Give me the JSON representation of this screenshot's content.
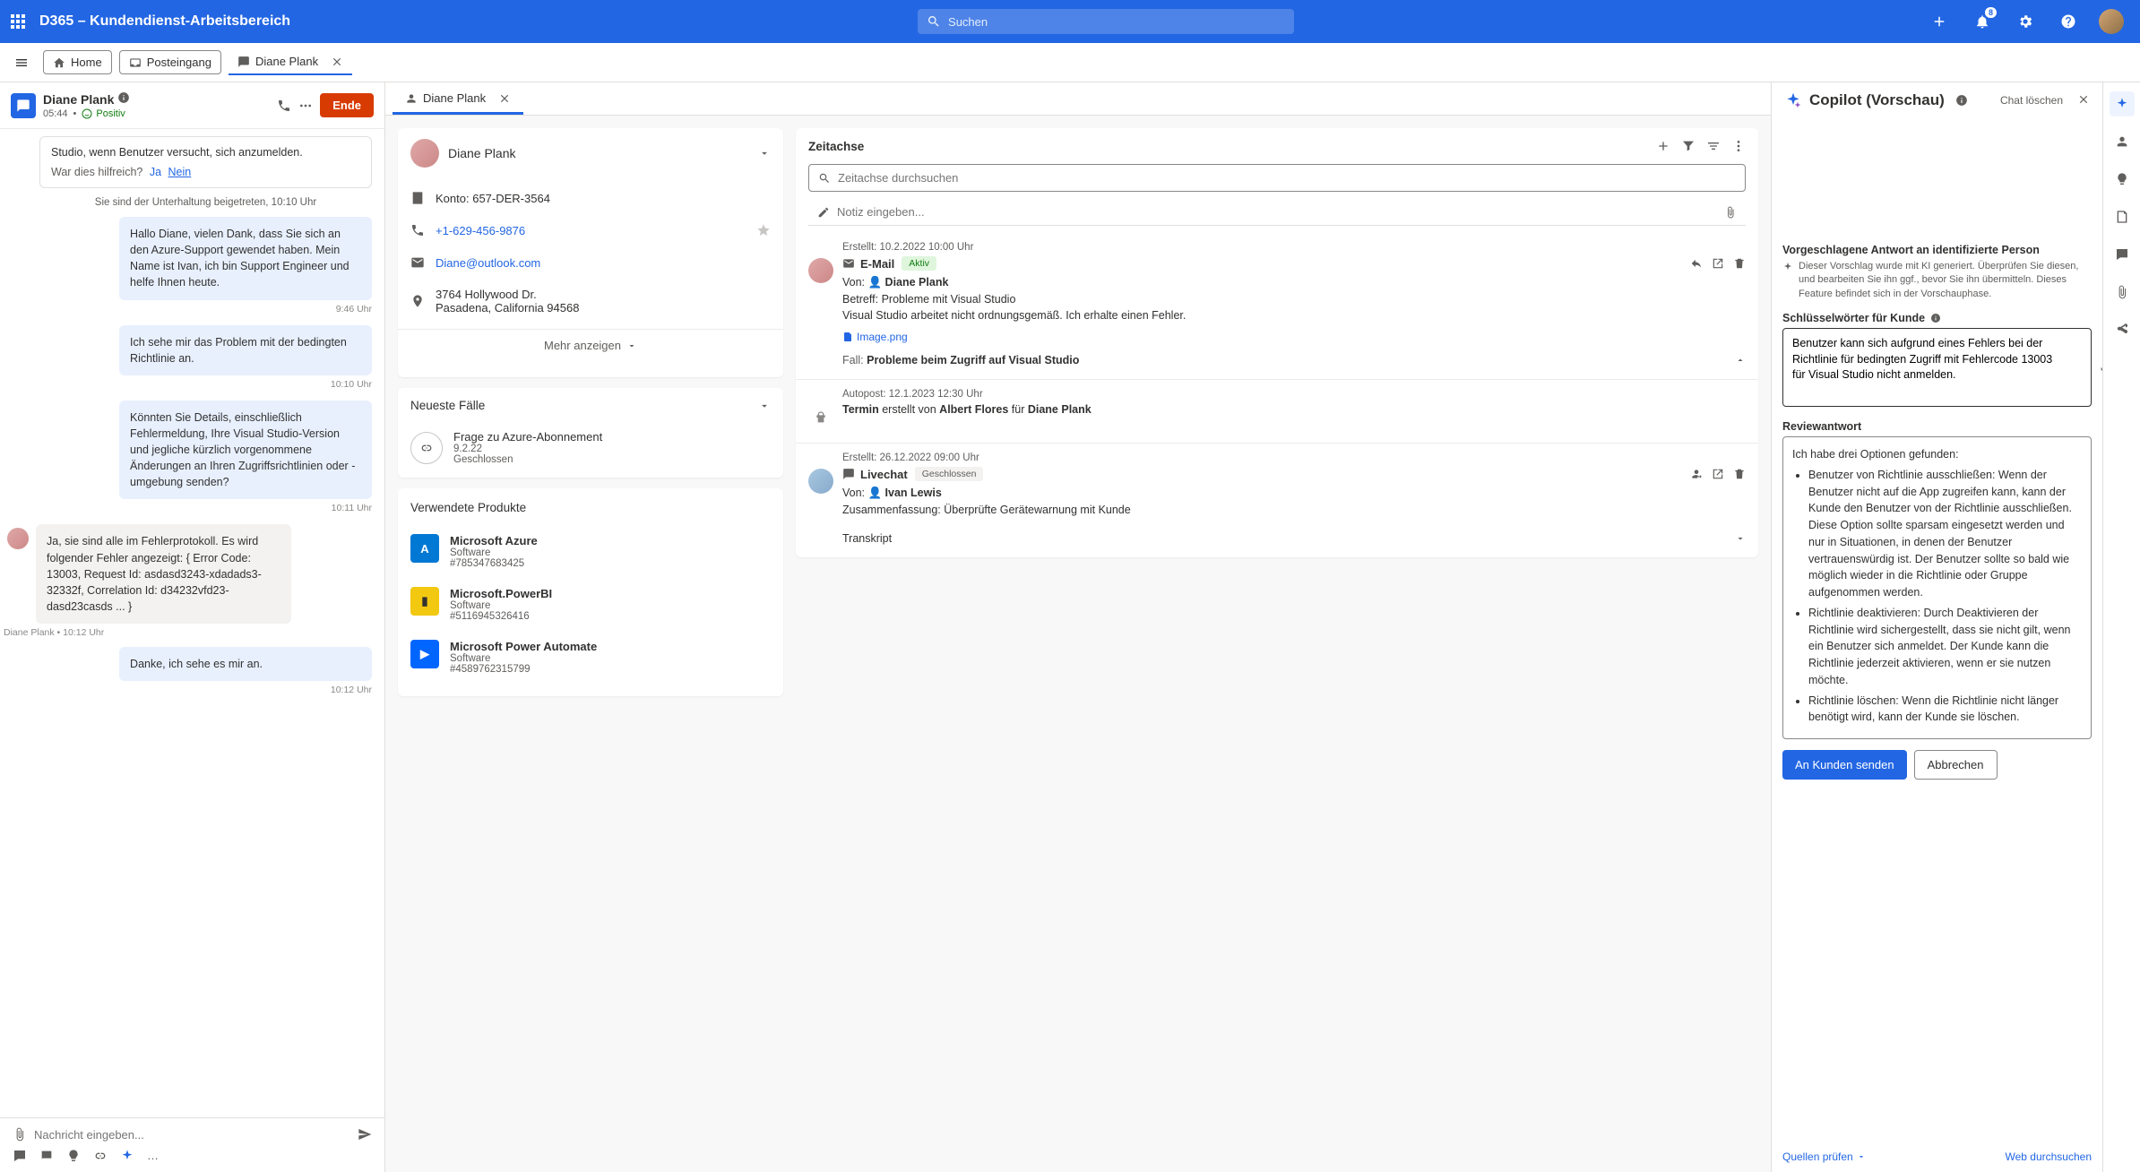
{
  "nav": {
    "app_title": "D365 – Kundendienst-Arbeitsbereich",
    "search_placeholder": "Suchen",
    "notification_count": "8"
  },
  "cmd": {
    "home": "Home",
    "inbox": "Posteingang",
    "tab_name": "Diane Plank"
  },
  "chat_header": {
    "name": "Diane Plank",
    "timer": "05:44",
    "sentiment": "Positiv",
    "end": "Ende"
  },
  "chat": {
    "knowledge_snippet": "Studio, wenn Benutzer versucht, sich anzumelden.",
    "helpful_q": "War dies hilfreich?",
    "yes": "Ja",
    "no": "Nein",
    "joined": "Sie sind der Unterhaltung beigetreten, 10:10 Uhr",
    "m1": "Hallo Diane, vielen Dank, dass Sie sich an den Azure-Support gewendet haben. Mein Name ist Ivan, ich bin Support Engineer und helfe Ihnen heute.",
    "t1": "9:46 Uhr",
    "m2": "Ich sehe mir das Problem mit der bedingten Richtlinie an.",
    "t2": "10:10 Uhr",
    "m3": "Könnten Sie Details, einschließlich Fehlermeldung, Ihre Visual Studio-Version und jegliche kürzlich vorgenommene Änderungen an Ihren Zugriffsrichtlinien oder -umgebung senden?",
    "t3": "10:11 Uhr",
    "m4": "Ja, sie sind alle im Fehlerprotokoll. Es wird folgender Fehler angezeigt: { Error Code: 13003, Request Id: asdasd3243-xdadads3-32332f, Correlation Id: d34232vfd23-dasd23casds ... }",
    "m4_meta": "Diane Plank  •  10:12 Uhr",
    "m5": "Danke, ich sehe es mir an.",
    "t5": "10:12 Uhr",
    "input_placeholder": "Nachricht eingeben..."
  },
  "inner_tab": "Diane Plank",
  "contact": {
    "name": "Diane Plank",
    "account_label": "Konto:",
    "account": "657-DER-3564",
    "phone": "+1-629-456-9876",
    "email": "Diane@outlook.com",
    "address1": "3764 Hollywood Dr.",
    "address2": "Pasadena, California 94568",
    "more": "Mehr anzeigen"
  },
  "recent_cases": {
    "title": "Neueste Fälle",
    "case1_title": "Frage zu Azure-Abonnement",
    "case1_date": "9.2.22",
    "case1_status": "Geschlossen"
  },
  "products": {
    "title": "Verwendete Produkte",
    "p1_name": "Microsoft Azure",
    "p1_type": "Software",
    "p1_id": "#785347683425",
    "p2_name": "Microsoft.PowerBI",
    "p2_type": "Software",
    "p2_id": "#5116945326416",
    "p3_name": "Microsoft Power Automate",
    "p3_type": "Software",
    "p3_id": "#4589762315799"
  },
  "timeline": {
    "title": "Zeitachse",
    "search_placeholder": "Zeitachse durchsuchen",
    "note_placeholder": "Notiz eingeben...",
    "i1_created": "Erstellt: 10.2.2022 10:00 Uhr",
    "i1_type": "E-Mail",
    "i1_badge": "Aktiv",
    "i1_from_label": "Von:",
    "i1_from": "Diane Plank",
    "i1_subject_label": "Betreff:",
    "i1_subject": "Probleme mit Visual Studio",
    "i1_body": "Visual Studio arbeitet nicht ordnungsgemäß. Ich erhalte einen Fehler.",
    "i1_attach": "Image.png",
    "i1_case_label": "Fall:",
    "i1_case": "Probleme beim Zugriff auf Visual Studio",
    "i2_created": "Autopost: 12.1.2023 12:30 Uhr",
    "i2_line_pre": "Termin",
    "i2_line_mid": "erstellt von",
    "i2_creator": "Albert Flores",
    "i2_for": "für",
    "i2_target": "Diane Plank",
    "i3_created": "Erstellt: 26.12.2022 09:00 Uhr",
    "i3_type": "Livechat",
    "i3_badge": "Geschlossen",
    "i3_from_label": "Von:",
    "i3_from": "Ivan Lewis",
    "i3_summary_label": "Zusammenfassung:",
    "i3_summary": "Überprüfte Gerätewarnung mit Kunde",
    "i3_transcript": "Transkript"
  },
  "copilot": {
    "title": "Copilot (Vorschau)",
    "clear": "Chat löschen",
    "suggest_title": "Vorgeschlagene Antwort an identifizierte Person",
    "suggest_hint": "Dieser Vorschlag wurde mit KI generiert. Überprüfen Sie diesen, und bearbeiten Sie ihn ggf., bevor Sie ihn übermitteln. Dieses Feature befindet sich in der Vorschauphase.",
    "keywords_label": "Schlüsselwörter für Kunde",
    "keywords_value": "Benutzer kann sich aufgrund eines Fehlers bei der Richtlinie für bedingten Zugriff mit Fehlercode 13003 für Visual Studio nicht anmelden.",
    "review_label": "Reviewantwort",
    "review_intro": "Ich habe drei Optionen gefunden:",
    "review_b1": "Benutzer von Richtlinie ausschließen: Wenn der Benutzer nicht auf die App zugreifen kann, kann der Kunde den Benutzer von der Richtlinie ausschließen. Diese Option sollte sparsam eingesetzt werden und nur in Situationen, in denen der Benutzer vertrauenswürdig ist. Der Benutzer sollte so bald wie möglich wieder in die Richtlinie oder Gruppe aufgenommen werden.",
    "review_b2": "Richtlinie deaktivieren: Durch Deaktivieren der Richtlinie wird sichergestellt, dass sie nicht gilt, wenn ein Benutzer sich anmeldet. Der Kunde kann die Richtlinie jederzeit aktivieren, wenn er sie nutzen möchte.",
    "review_b3": "Richtlinie löschen: Wenn die Richtlinie nicht länger benötigt wird, kann der Kunde sie löschen.",
    "send": "An Kunden senden",
    "cancel": "Abbrechen",
    "sources": "Quellen prüfen",
    "web": "Web durchsuchen"
  }
}
